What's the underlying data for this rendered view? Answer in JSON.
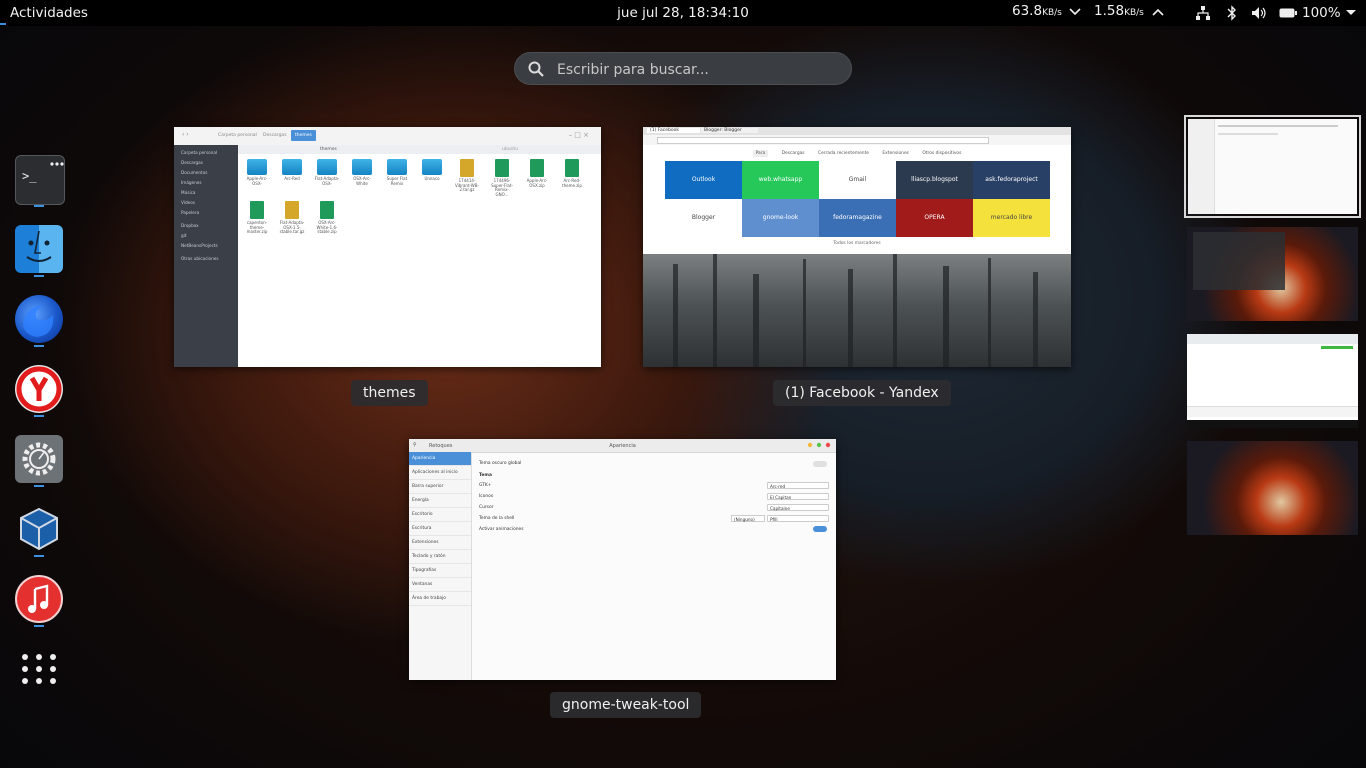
{
  "topbar": {
    "activities": "Actividades",
    "clock": "jue jul 28, 18:34:10",
    "net_down_value": "63.8",
    "net_down_unit": "KB/s",
    "net_up_value": "1.58",
    "net_up_unit": "KB/s",
    "battery": "100%",
    "tray_icons": [
      "network-icon",
      "bluetooth-icon",
      "volume-icon",
      "battery-icon",
      "power-menu-icon"
    ]
  },
  "search": {
    "placeholder": "Escribir para buscar..."
  },
  "dash": {
    "apps": [
      "terminal",
      "file-manager",
      "firefox",
      "yandex-browser",
      "settings",
      "virtualbox",
      "music-player"
    ],
    "show_apps": "show-applications"
  },
  "windows": {
    "files": {
      "caption": "themes",
      "path": [
        "Carpeta personal",
        "Descargas",
        "themes"
      ],
      "tabs": [
        "themes",
        "ubuntu"
      ],
      "sidebar": [
        "Carpeta personal",
        "Descargas",
        "Documentos",
        "Imágenes",
        "Música",
        "Vídeos",
        "Papelera",
        "Dropbox",
        "git",
        "NetBeansProjects",
        "Otras ubicaciones"
      ],
      "items": [
        {
          "name": "Apple-Arc-OSX-",
          "type": "folder"
        },
        {
          "name": "Arc-Red",
          "type": "folder"
        },
        {
          "name": "Flat-Adapta-OSX-",
          "type": "folder"
        },
        {
          "name": "OSX-Arc-White",
          "type": "folder"
        },
        {
          "name": "Super Flat Remix",
          "type": "folder"
        },
        {
          "name": "Unnaco",
          "type": "folder"
        },
        {
          "name": "174414-Vibrant-WB-2.tar.gz",
          "type": "zip-yellow"
        },
        {
          "name": "174496-Super-Flat-Remix-GNO...",
          "type": "zip-green"
        },
        {
          "name": "Apple-Arc-OSX.zip",
          "type": "zip-green"
        },
        {
          "name": "Arc-Red-theme.zip",
          "type": "zip-green"
        },
        {
          "name": "capenton-theme-master.zip",
          "type": "zip-green"
        },
        {
          "name": "Flat-Adapta-OSX-1.5-stable.tar.gz",
          "type": "zip-yellow"
        },
        {
          "name": "OSX-Arc-White-1.6-stable.zip",
          "type": "zip-green"
        }
      ]
    },
    "browser": {
      "caption": "(1) Facebook - Yandex",
      "tabs": [
        "(1) Facebook",
        "Blogger: Blogger"
      ],
      "links": [
        "Para",
        "Descargas",
        "Cerrada recientemente",
        "Extensiones",
        "Otros dispositivos"
      ],
      "tiles": [
        {
          "label": "Outlook",
          "color": "#0f6cc0"
        },
        {
          "label": "web.whatsapp",
          "color": "#26c85a"
        },
        {
          "label": "Gmail",
          "color": "#ffffff"
        },
        {
          "label": "lliascp.blogspot",
          "color": "#2b3a4f"
        },
        {
          "label": "ask.fedoraproject",
          "color": "#294066"
        },
        {
          "label": "Blogger",
          "color": "#ffffff"
        },
        {
          "label": "gnome-look",
          "color": "#5f8fcf"
        },
        {
          "label": "fedoramagazine",
          "color": "#3a6fb5"
        },
        {
          "label": "OPERA",
          "color": "#a11b1b"
        },
        {
          "label": "mercado libre",
          "color": "#f5e13c"
        }
      ],
      "footer": "Todos los marcadores"
    },
    "tweaks": {
      "caption": "gnome-tweak-tool",
      "title": "Apariencia",
      "search_label": "Retoques",
      "sidebar": [
        "Apariencia",
        "Aplicaciones al inicio",
        "Barra superior",
        "Energía",
        "Escritorio",
        "Escritura",
        "Extensiones",
        "Teclado y ratón",
        "Tipografías",
        "Ventanas",
        "Área de trabajo"
      ],
      "rows": [
        {
          "label": "Tema oscuro global",
          "value": ""
        },
        {
          "label": "Tema",
          "value": ""
        },
        {
          "label": "GTK+",
          "value": "Arc-red"
        },
        {
          "label": "Iconos",
          "value": "El Capitan"
        },
        {
          "label": "Cursor",
          "value": "Capitaine"
        },
        {
          "label": "Tema de la shell",
          "value": "Pfill"
        },
        {
          "label": "Activar animaciones",
          "value": ""
        }
      ],
      "shell_theme_button": "(Ninguno)"
    }
  }
}
